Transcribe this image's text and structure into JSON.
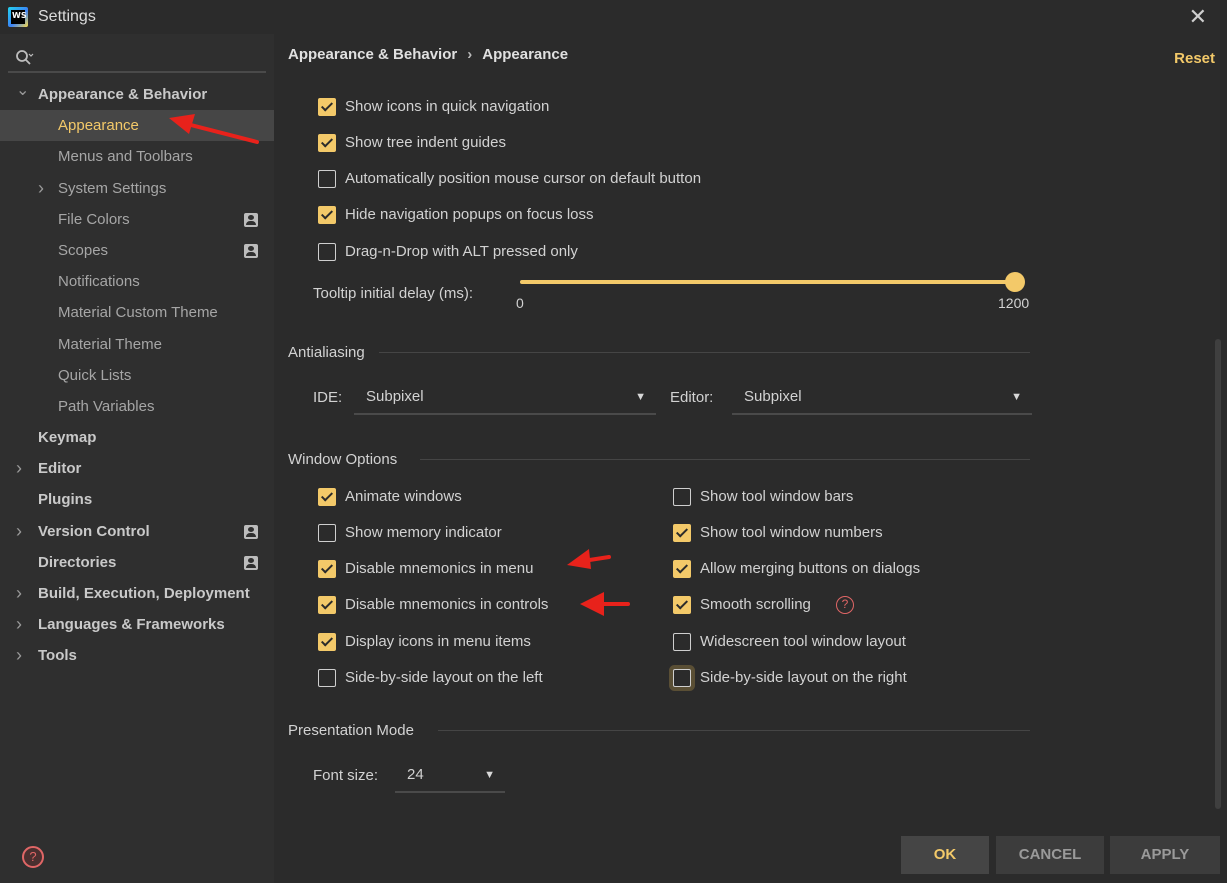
{
  "window": {
    "title": "Settings",
    "app_badge": "WS"
  },
  "search": {
    "placeholder": ""
  },
  "sidebar": {
    "items": [
      {
        "label": "Appearance & Behavior",
        "level": 0,
        "expanded": true
      },
      {
        "label": "Appearance",
        "level": 1,
        "selected": true
      },
      {
        "label": "Menus and Toolbars",
        "level": 1
      },
      {
        "label": "System Settings",
        "level": 1,
        "collapsed": true
      },
      {
        "label": "File Colors",
        "level": 1,
        "badge": "project-icon"
      },
      {
        "label": "Scopes",
        "level": 1,
        "badge": "project-icon"
      },
      {
        "label": "Notifications",
        "level": 1
      },
      {
        "label": "Material Custom Theme",
        "level": 1
      },
      {
        "label": "Material Theme",
        "level": 1
      },
      {
        "label": "Quick Lists",
        "level": 1
      },
      {
        "label": "Path Variables",
        "level": 1
      },
      {
        "label": "Keymap",
        "level": 0
      },
      {
        "label": "Editor",
        "level": 0,
        "collapsed": true
      },
      {
        "label": "Plugins",
        "level": 0
      },
      {
        "label": "Version Control",
        "level": 0,
        "collapsed": true,
        "badge": "project-icon"
      },
      {
        "label": "Directories",
        "level": 0,
        "badge": "project-icon"
      },
      {
        "label": "Build, Execution, Deployment",
        "level": 0,
        "collapsed": true
      },
      {
        "label": "Languages & Frameworks",
        "level": 0,
        "collapsed": true
      },
      {
        "label": "Tools",
        "level": 0,
        "collapsed": true
      }
    ]
  },
  "breadcrumb": {
    "parent": "Appearance & Behavior",
    "separator": "›",
    "current": "Appearance"
  },
  "reset_label": "Reset",
  "ui_options": [
    {
      "label": "Show icons in quick navigation",
      "checked": true
    },
    {
      "label": "Show tree indent guides",
      "checked": true
    },
    {
      "label": "Automatically position mouse cursor on default button",
      "checked": false
    },
    {
      "label": "Hide navigation popups on focus loss",
      "checked": true
    },
    {
      "label": "Drag-n-Drop with ALT pressed only",
      "checked": false
    }
  ],
  "tooltip": {
    "label": "Tooltip initial delay (ms):",
    "min": "0",
    "max": "1200",
    "value": 1200
  },
  "antialiasing": {
    "title": "Antialiasing",
    "ide_label": "IDE:",
    "ide_value": "Subpixel",
    "editor_label": "Editor:",
    "editor_value": "Subpixel"
  },
  "window_options": {
    "title": "Window Options",
    "left": [
      {
        "label": "Animate windows",
        "checked": true
      },
      {
        "label": "Show memory indicator",
        "checked": false
      },
      {
        "label": "Disable mnemonics in menu",
        "checked": true
      },
      {
        "label": "Disable mnemonics in controls",
        "checked": true
      },
      {
        "label": "Display icons in menu items",
        "checked": true
      },
      {
        "label": "Side-by-side layout on the left",
        "checked": false
      }
    ],
    "right": [
      {
        "label": "Show tool window bars",
        "checked": false
      },
      {
        "label": "Show tool window numbers",
        "checked": true
      },
      {
        "label": "Allow merging buttons on dialogs",
        "checked": true
      },
      {
        "label": "Smooth scrolling",
        "checked": true
      },
      {
        "label": "Widescreen tool window layout",
        "checked": false
      },
      {
        "label": "Side-by-side layout on the right",
        "checked": false
      }
    ]
  },
  "presentation": {
    "title": "Presentation Mode",
    "font_label": "Font size:",
    "font_value": "24"
  },
  "buttons": {
    "ok": "OK",
    "cancel": "CANCEL",
    "apply": "APPLY"
  },
  "help_glyph": "?",
  "colors": {
    "accent": "#f3c969",
    "background": "#2b2b2b",
    "sidebar": "#2f2f2f",
    "selected_row": "#464646",
    "annotation_arrow": "#e8221b",
    "help": "#e06666"
  }
}
